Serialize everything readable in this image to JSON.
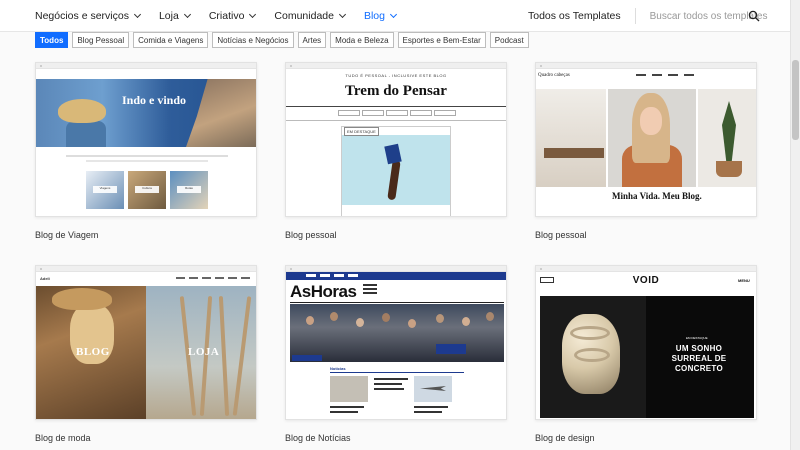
{
  "nav": {
    "items": [
      {
        "label": "Negócios e serviços",
        "active": false
      },
      {
        "label": "Loja",
        "active": false
      },
      {
        "label": "Criativo",
        "active": false
      },
      {
        "label": "Comunidade",
        "active": false
      },
      {
        "label": "Blog",
        "active": true
      }
    ],
    "templates_link": "Todos os Templates",
    "search_placeholder": "Buscar todos os templates..."
  },
  "filters": [
    {
      "label": "Todos",
      "active": true
    },
    {
      "label": "Blog Pessoal",
      "active": false
    },
    {
      "label": "Comida e Viagens",
      "active": false
    },
    {
      "label": "Notícias e Negócios",
      "active": false
    },
    {
      "label": "Artes",
      "active": false
    },
    {
      "label": "Moda e Beleza",
      "active": false
    },
    {
      "label": "Esportes e Bem-Estar",
      "active": false
    },
    {
      "label": "Podcast",
      "active": false
    }
  ],
  "templates": [
    {
      "label": "Blog de Viagem",
      "preview_title": "Indo e vindo",
      "preview_tags": [
        "Viagens",
        "Cultura",
        "Rotas"
      ]
    },
    {
      "label": "Blog pessoal",
      "preview_kicker": "TUDO É PESSOAL - INCLUSIVE ESTE BLOG",
      "preview_title": "Trem do Pensar",
      "preview_badge": "EM DESTAQUE"
    },
    {
      "label": "Blog pessoal",
      "preview_logo": "Quadro cabeças",
      "preview_title": "Minha Vida. Meu Blog."
    },
    {
      "label": "Blog de moda",
      "preview_logo": "Adeli",
      "preview_left": "BLOG",
      "preview_right": "LOJA"
    },
    {
      "label": "Blog de Notícias",
      "preview_title": "AsHoras",
      "preview_section": "Notícias"
    },
    {
      "label": "Blog de design",
      "preview_title": "VOID",
      "preview_menu": "MENU",
      "preview_kicker": "EM DESTAQUE",
      "preview_headline": "UM SONHO SURREAL DE CONCRETO"
    }
  ],
  "colors": {
    "accent": "#116dff",
    "news_blue": "#1d3a8f"
  },
  "icons": {
    "search": "magnifier",
    "chevron": "chevron-down"
  }
}
